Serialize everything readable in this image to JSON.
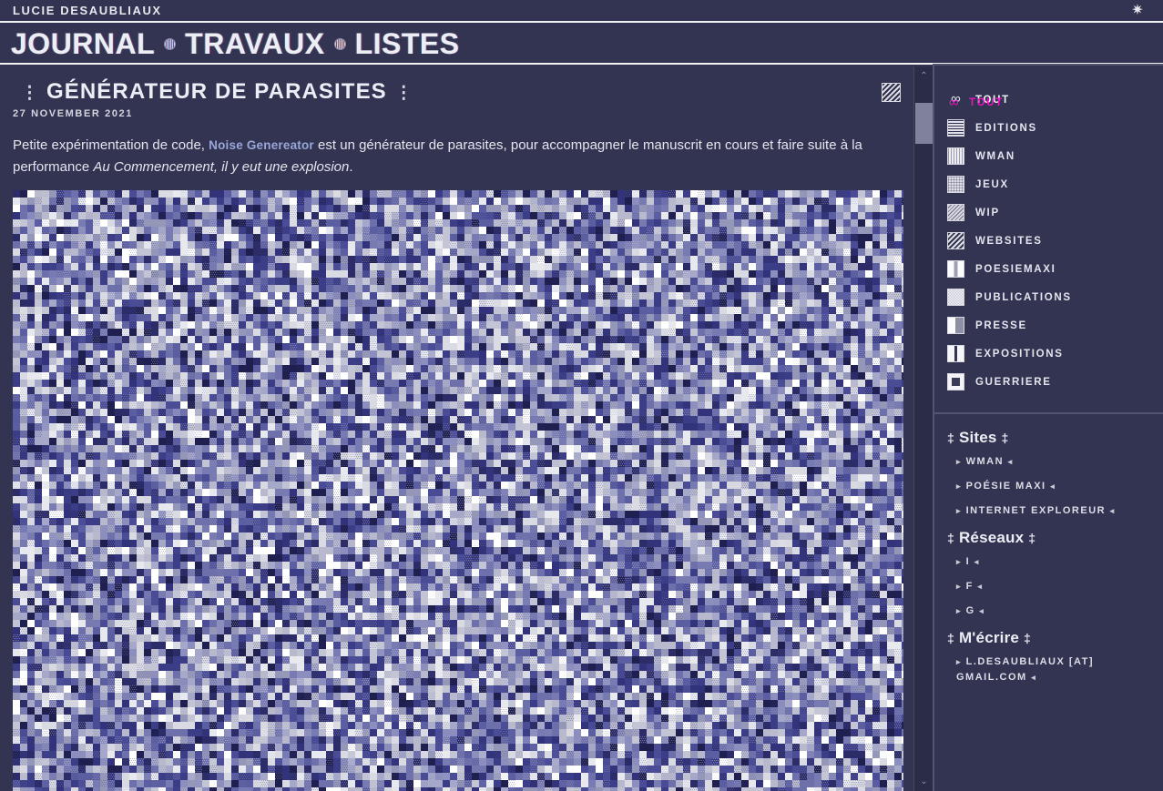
{
  "theme": {
    "bg": "#333452",
    "rule": "#f2f2f5",
    "text": "#e4e5ee",
    "accent_magenta": "#f012be",
    "link_blue": "#98a7d8",
    "sidebar_border": "#53546f",
    "scroll_thumb": "#80829c"
  },
  "topbar": {
    "site_name": "LUCIE DESAUBLIAUX",
    "theme_toggle_icon": "sun-icon",
    "theme_toggle_glyph": "✷"
  },
  "mainnav": {
    "items": [
      {
        "label": "JOURNAL",
        "active": true,
        "ghost": "JOURNAL"
      },
      {
        "label": "TRAVAUX",
        "active": false,
        "ghost": ""
      },
      {
        "label": "LISTES",
        "active": false,
        "ghost": ""
      }
    ],
    "separator_icon": "striped-circle-icon"
  },
  "article": {
    "decor_left": "⋮",
    "decor_right": "⋮",
    "title": "GÉNÉRATEUR DE PARASITES",
    "date": "27 NOVEMBER 2021",
    "category_badge_icon": "diagonal-stripes-icon",
    "body": {
      "part1": "Petite expérimentation de code, ",
      "link_text": "Noise Genereator",
      "part2": " est un générateur de parasites, pour accompagner le manuscrit en cours et faire suite à la performance ",
      "italic_text": "Au Commencement, il y eut une explosion",
      "part3": "."
    },
    "image_alt": "noise-generator-output"
  },
  "scrollbar": {
    "up_glyph": "⌃",
    "down_glyph": "⌄"
  },
  "sidebar": {
    "categories": [
      {
        "label": "TOUT",
        "icon": "infinity-icon",
        "active": true,
        "ghost": "TOUT"
      },
      {
        "label": "EDITIONS",
        "icon": "lines-icon",
        "active": false,
        "ghost": ""
      },
      {
        "label": "WMAN",
        "icon": "vertical-bars-icon",
        "active": false,
        "ghost": ""
      },
      {
        "label": "JEUX",
        "icon": "grid-icon",
        "active": false,
        "ghost": ""
      },
      {
        "label": "WIP",
        "icon": "thin-diagonal-icon",
        "active": false,
        "ghost": ""
      },
      {
        "label": "WEBSITES",
        "icon": "bold-diagonal-icon",
        "active": false,
        "ghost": ""
      },
      {
        "label": "POESIEMAXI",
        "icon": "half-left-icon",
        "active": false,
        "ghost": ""
      },
      {
        "label": "PUBLICATIONS",
        "icon": "dither-icon",
        "active": false,
        "ghost": ""
      },
      {
        "label": "PRESSE",
        "icon": "half-solid-icon",
        "active": false,
        "ghost": ""
      },
      {
        "label": "EXPOSITIONS",
        "icon": "two-column-icon",
        "active": false,
        "ghost": ""
      },
      {
        "label": "GUERRIERE",
        "icon": "framed-square-icon",
        "active": false,
        "ghost": ""
      }
    ],
    "sections": [
      {
        "heading": "Sites",
        "links": [
          "WMAN",
          "POÉSIE MAXI",
          "INTERNET EXPLOREUR"
        ]
      },
      {
        "heading": "Réseaux",
        "links": [
          "I",
          "F",
          "G"
        ]
      },
      {
        "heading": "M'écrire",
        "links": [
          "L.DESAUBLIAUX [AT] GMAIL.COM"
        ]
      }
    ],
    "heading_marker": "‡",
    "bullet_left": "▸",
    "bullet_right": "◂"
  }
}
